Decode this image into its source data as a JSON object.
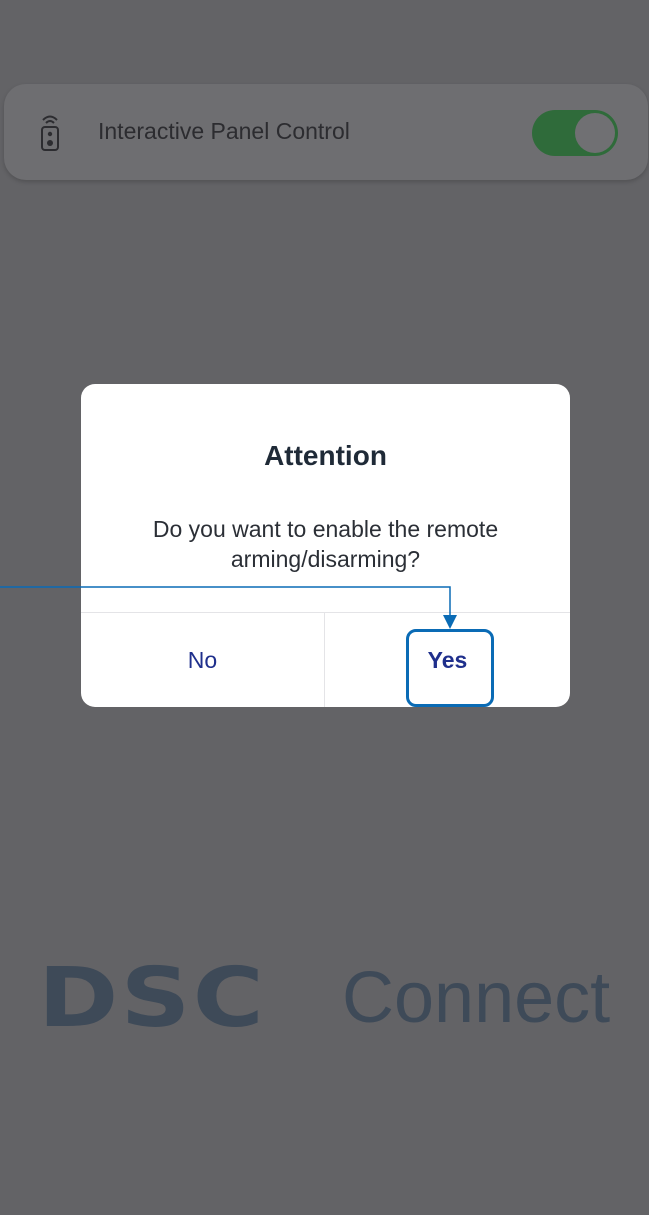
{
  "setting": {
    "label": "Interactive Panel Control",
    "toggle_state": "on",
    "icon": "remote-control-icon"
  },
  "logo": {
    "brand": "DSC",
    "suffix": "Connect"
  },
  "dialog": {
    "title": "Attention",
    "message": "Do you want to enable the remote arming/disarming?",
    "no_label": "No",
    "yes_label": "Yes"
  },
  "colors": {
    "overlay": "#636366",
    "dialog_bg": "#ffffff",
    "button_text": "#1f2f8c",
    "toggle_on": "#2f6b3a",
    "annotation": "#0a6bb5"
  }
}
